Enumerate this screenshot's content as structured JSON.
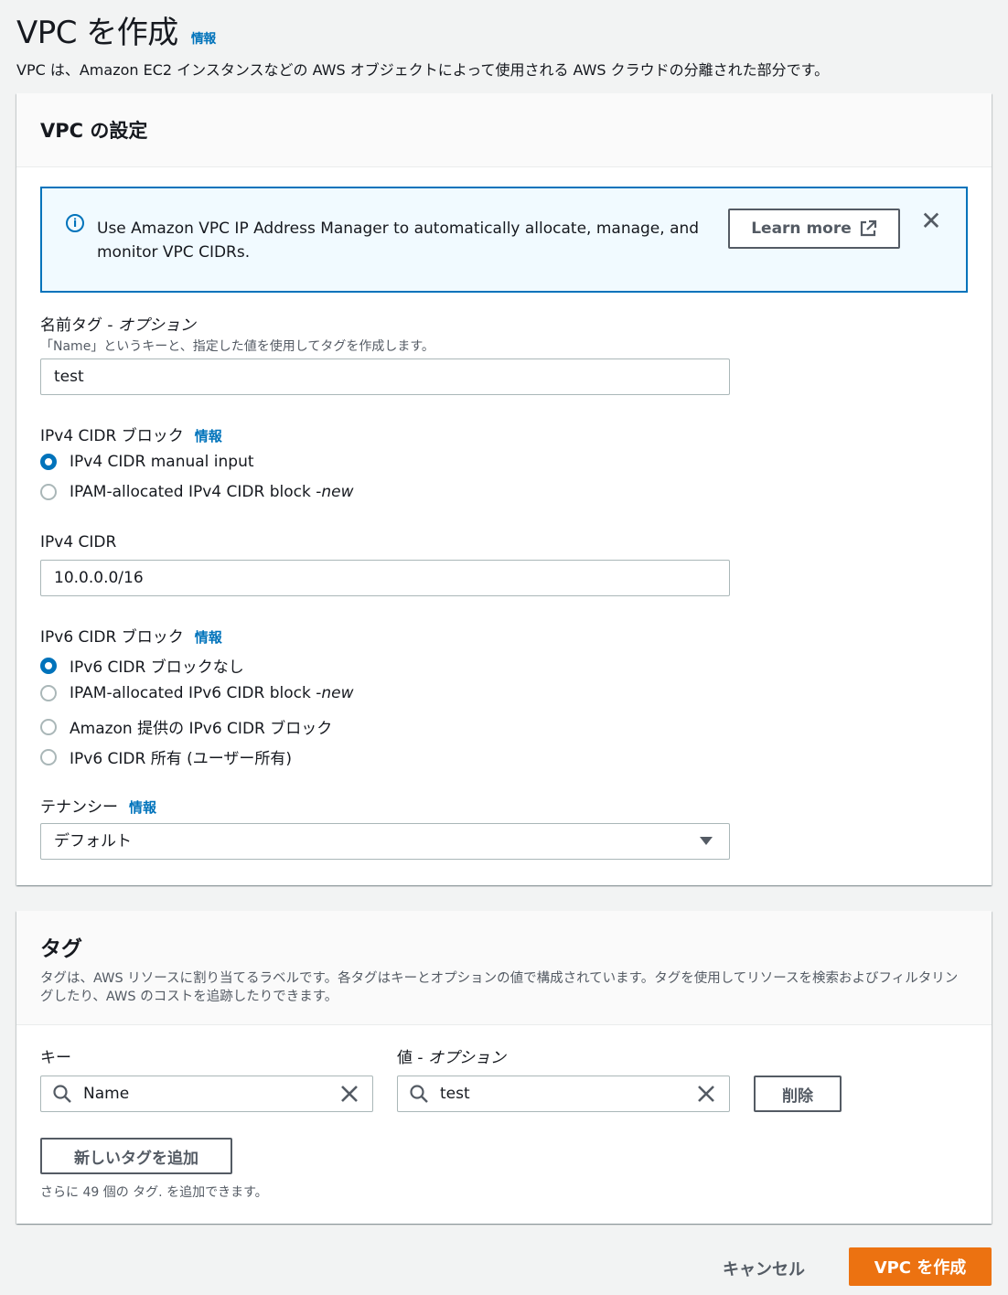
{
  "page": {
    "title": "VPC を作成",
    "info": "情報",
    "description": "VPC は、Amazon EC2 インスタンスなどの AWS オブジェクトによって使用される AWS クラウドの分離された部分です。"
  },
  "vpc_settings": {
    "title": "VPC の設定",
    "alert": {
      "text": "Use Amazon VPC IP Address Manager to automatically allocate, manage, and monitor VPC CIDRs.",
      "learn_more": "Learn more"
    },
    "name_tag": {
      "label": "名前タグ - ",
      "optional": "オプション",
      "description": "「Name」というキーと、指定した値を使用してタグを作成します。",
      "value": "test"
    },
    "ipv4_block": {
      "label": "IPv4 CIDR ブロック",
      "info": "情報",
      "options": [
        {
          "label": "IPv4 CIDR manual input",
          "suffix": "",
          "checked": true
        },
        {
          "label": "IPAM-allocated IPv4 CIDR block - ",
          "suffix": "new",
          "checked": false
        }
      ]
    },
    "ipv4_cidr": {
      "label": "IPv4 CIDR",
      "value": "10.0.0.0/16"
    },
    "ipv6_block": {
      "label": "IPv6 CIDR ブロック",
      "info": "情報",
      "options": [
        {
          "label": "IPv6 CIDR ブロックなし",
          "suffix": "",
          "checked": true
        },
        {
          "label": "IPAM-allocated IPv6 CIDR block - ",
          "suffix": "new",
          "checked": false
        },
        {
          "label": "Amazon 提供の IPv6 CIDR ブロック",
          "suffix": "",
          "checked": false
        },
        {
          "label": "IPv6 CIDR 所有 (ユーザー所有)",
          "suffix": "",
          "checked": false
        }
      ]
    },
    "tenancy": {
      "label": "テナンシー",
      "info": "情報",
      "value": "デフォルト"
    }
  },
  "tags": {
    "title": "タグ",
    "description": "タグは、AWS リソースに割り当てるラベルです。各タグはキーとオプションの値で構成されています。タグを使用してリソースを検索およびフィルタリングしたり、AWS のコストを追跡したりできます。",
    "key_label": "キー",
    "value_label": "値 - ",
    "value_optional": "オプション",
    "key_value": "Name",
    "value_value": "test",
    "remove": "削除",
    "add_tag": "新しいタグを追加",
    "limit": "さらに 49 個の タグ. を追加できます。"
  },
  "footer": {
    "cancel": "キャンセル",
    "create": "VPC を作成"
  },
  "colors": {
    "accent": "#0073bb",
    "primary_button": "#ec7211"
  }
}
